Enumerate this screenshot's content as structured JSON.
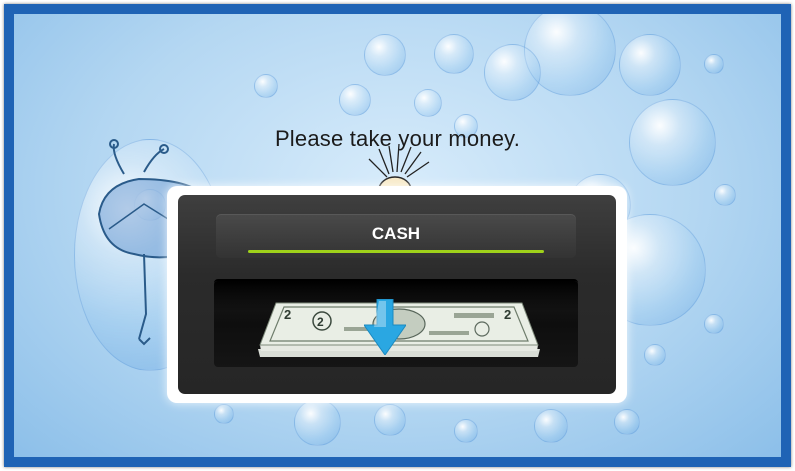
{
  "screen": {
    "message": "Please take your money."
  },
  "dispenser": {
    "label": "CASH"
  },
  "icons": {
    "banknote": "banknote-stack-icon",
    "arrow": "arrow-down-icon"
  },
  "colors": {
    "frame": "#1f63b5",
    "background": "#b4d7f2",
    "cash_bar": "#9fd21a",
    "arrow": "#2aa7e2"
  }
}
